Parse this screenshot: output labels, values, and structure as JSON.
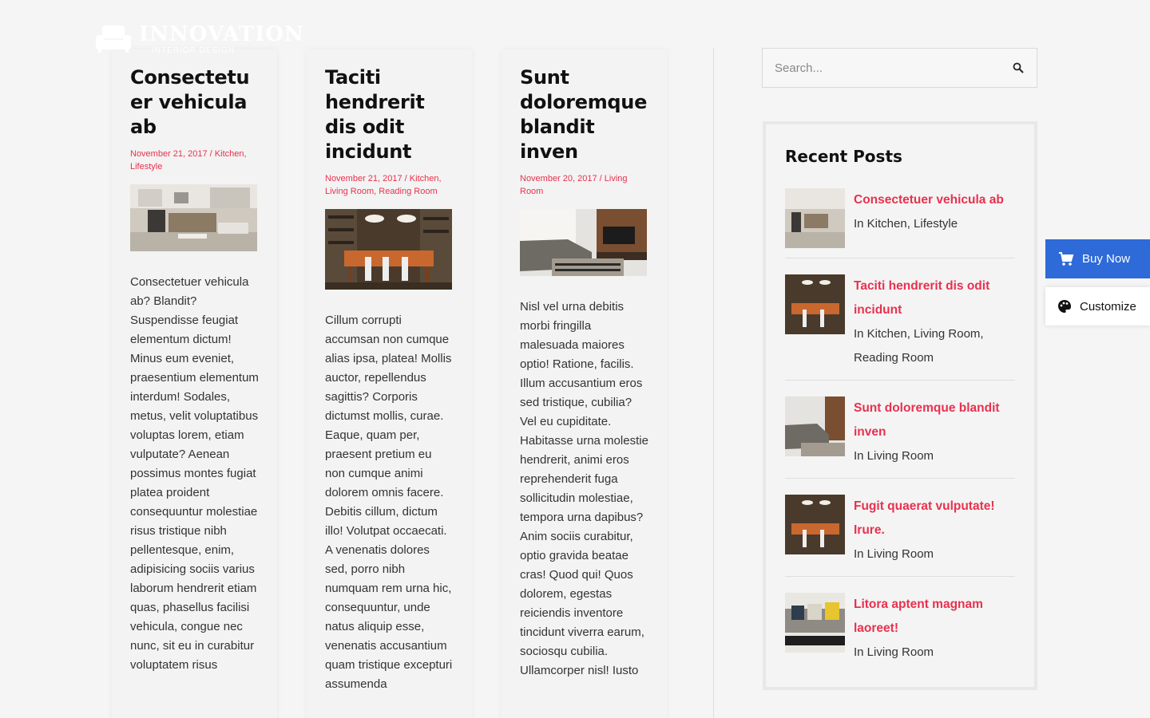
{
  "logo": {
    "name": "INNOVATION",
    "tagline": "INTERIOR DESIGN"
  },
  "posts": [
    {
      "title": "Consectetuer vehicula ab",
      "meta": "November 21, 2017 / Kitchen, Lifestyle",
      "image": "kitchen-photo",
      "excerpt": "Consectetuer vehicula ab? Blandit? Suspendisse feugiat elementum dictum! Minus eum eveniet, praesentium elementum interdum! Sodales, metus, velit voluptatibus voluptas lorem, etiam vulputate? Aenean possimus montes fugiat platea proident consequuntur molestiae risus tristique nibh pellentesque, enim, adipisicing sociis varius laborum hendrerit etiam quas, phasellus facilisi vehicula, congue nec nunc, sit eu in curabitur voluptatem risus"
    },
    {
      "title": "Taciti hendrerit dis odit incidunt",
      "meta": "November 21, 2017 / Kitchen, Living Room, Reading Room",
      "image": "dining-room-photo",
      "excerpt": "Cillum corrupti accumsan non cumque alias ipsa, platea! Mollis auctor, repellendus sagittis? Corporis dictumst mollis, curae. Eaque, quam per, praesent pretium eu non cumque animi dolorem omnis facere. Debitis cillum, dictum illo! Volutpat occaecati. A venenatis dolores sed, porro nibh numquam rem urna hic, consequuntur, unde natus aliquip esse, venenatis accusantium quam tristique excepturi assumenda"
    },
    {
      "title": "Sunt doloremque blandit inven",
      "meta": "November 20, 2017 / Living Room",
      "image": "living-room-photo",
      "excerpt": "Nisl vel urna debitis morbi fringilla malesuada maiores optio! Ratione, facilis. Illum accusantium eros sed tristique, cubilia? Vel eu cupiditate. Habitasse urna molestie hendrerit, animi eros reprehenderit fuga sollicitudin molestiae, tempora urna dapibus? Anim sociis curabitur, optio gravida beatae cras! Quod qui! Quos dolorem, egestas reiciendis inventore tincidunt viverra earum, sociosqu cubilia. Ullamcorper nisl! Iusto"
    }
  ],
  "search": {
    "placeholder": "Search..."
  },
  "recent_posts": {
    "heading": "Recent Posts",
    "items": [
      {
        "title": "Consectetuer vehicula ab",
        "category": "In Kitchen, Lifestyle",
        "image": "kitchen"
      },
      {
        "title": "Taciti hendrerit dis odit incidunt",
        "category": "In Kitchen, Living Room, Reading Room",
        "image": "dining"
      },
      {
        "title": "Sunt doloremque blandit inven",
        "category": "In Living Room",
        "image": "living"
      },
      {
        "title": "Fugit quaerat vulputate! Irure.",
        "category": "In Living Room",
        "image": "dining"
      },
      {
        "title": "Litora aptent magnam laoreet!",
        "category": "In Living Room",
        "image": "sofa"
      }
    ]
  },
  "floating": {
    "buy_now": "Buy Now",
    "customize": "Customize"
  },
  "colors": {
    "accent": "#e8314e",
    "buy_button": "#2e6ad8",
    "background": "#f5f5f5"
  }
}
